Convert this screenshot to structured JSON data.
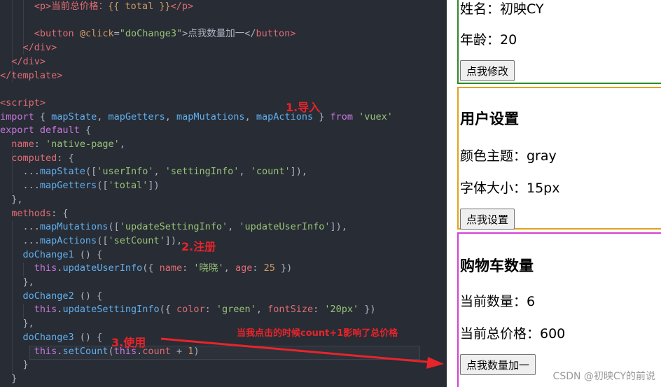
{
  "editor": {
    "code_lines": [
      [
        "      ",
        "<p>当前总价格：",
        "{{ total }}",
        "</p>"
      ],
      [
        ""
      ],
      [
        "      ",
        "<button",
        " @click",
        "=",
        "\"doChange3\"",
        ">点我数量加一</",
        "button>"
      ],
      [
        "    ",
        "</div>"
      ],
      [
        "  ",
        "</div>"
      ],
      [
        "",
        "</template>"
      ],
      [
        ""
      ],
      [
        "",
        "<script>"
      ],
      [
        "",
        "import",
        " { ",
        "mapState",
        ", ",
        "mapGetters",
        ", ",
        "mapMutations",
        ", ",
        "mapActions",
        " } ",
        "from",
        " ",
        "'vuex'"
      ],
      [
        "",
        "export",
        " ",
        "default",
        " {"
      ],
      [
        "  ",
        "name",
        ": ",
        "'native-page'",
        ","
      ],
      [
        "  ",
        "computed",
        ": {"
      ],
      [
        "    ...",
        "mapState",
        "([",
        "'userInfo'",
        ", ",
        "'settingInfo'",
        ", ",
        "'count'",
        "]),"
      ],
      [
        "    ...",
        "mapGetters",
        "([",
        "'total'",
        "])"
      ],
      [
        "  },"
      ],
      [
        "  ",
        "methods",
        ": {"
      ],
      [
        "    ...",
        "mapMutations",
        "([",
        "'updateSettingInfo'",
        ", ",
        "'updateUserInfo'",
        "]),"
      ],
      [
        "    ...",
        "mapActions",
        "([",
        "'setCount'",
        "]),"
      ],
      [
        "    ",
        "doChange1",
        " () {"
      ],
      [
        "      ",
        "this",
        ".",
        "updateUserInfo",
        "({ ",
        "name",
        ": ",
        "'晓晓'",
        ", ",
        "age",
        ": ",
        "25",
        " })"
      ],
      [
        "    },"
      ],
      [
        "    ",
        "doChange2",
        " () {"
      ],
      [
        "      ",
        "this",
        ".",
        "updateSettingInfo",
        "({ ",
        "color",
        ": ",
        "'green'",
        ", ",
        "fontSize",
        ": ",
        "'20px'",
        " })"
      ],
      [
        "    },"
      ],
      [
        "    ",
        "doChange3",
        " () {"
      ],
      [
        "      ",
        "this",
        ".",
        "setCount",
        "(",
        "this",
        ".",
        "count",
        " + ",
        "1",
        ")"
      ],
      [
        "    }"
      ],
      [
        "  }"
      ]
    ],
    "annotations": {
      "import": "1.导入",
      "register": "2.注册",
      "use": "3.使用",
      "note": "当我点击的时候count+1影响了总价格"
    }
  },
  "preview": {
    "user": {
      "name_line": "姓名：初映CY",
      "age_line": "年龄：20",
      "button": "点我修改"
    },
    "setting": {
      "title": "用户设置",
      "color_line": "颜色主题：gray",
      "font_line": "字体大小：15px",
      "button": "点我设置"
    },
    "cart": {
      "title": "购物车数量",
      "count_line": "当前数量：6",
      "total_line": "当前总价格：600",
      "button": "点我数量加一"
    },
    "watermark": "CSDN @初映CY的前说"
  },
  "colors": {
    "editor_bg": "#282c34",
    "annotation_red": "#e8242b",
    "user_border": "#2b8a2b",
    "setting_border": "#e3a21a",
    "cart_border": "#d63fd6"
  }
}
